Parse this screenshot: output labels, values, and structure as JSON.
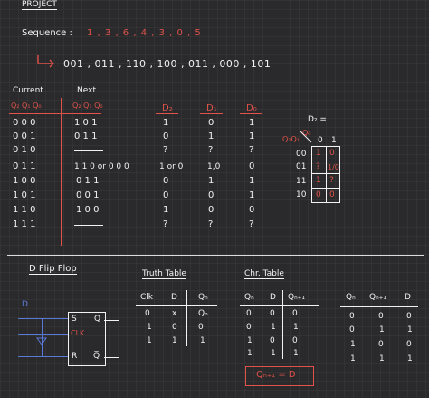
{
  "header": {
    "title": "PROJECT",
    "sequence_label": "Sequence :",
    "sequence_values": "1 , 3 , 6 , 4 , 3 , 0 , 5",
    "binary_sequence": "001 , 011 , 110 , 100 , 011 , 000 , 101"
  },
  "state_table": {
    "current_header": "Current",
    "next_header": "Next",
    "current_sub": "Q₂ Q₁ Q₀",
    "next_sub": "Q₂ Q₁ Q₀",
    "d_headers": [
      "D₂",
      "D₁",
      "D₀"
    ],
    "rows": [
      {
        "cur": "0  0  0",
        "next": "1  0  1",
        "d2": "1",
        "d1": "0",
        "d0": "1"
      },
      {
        "cur": "0  0  1",
        "next": "0  1  1",
        "d2": "0",
        "d1": "1",
        "d0": "1"
      },
      {
        "cur": "0  1  0",
        "next": "",
        "d2": "?",
        "d1": "?",
        "d0": "?"
      },
      {
        "cur": "0  1  1",
        "next": "1 1 0   or   0 0 0",
        "d2": "1 or 0",
        "d1": "1,0",
        "d0": "0"
      },
      {
        "cur": "1  0  0",
        "next": "0 1 1",
        "d2": "0",
        "d1": "1",
        "d0": "1"
      },
      {
        "cur": "1  0  1",
        "next": "0 0 1",
        "d2": "0",
        "d1": "0",
        "d0": "1"
      },
      {
        "cur": "1  1  0",
        "next": "1 0 0",
        "d2": "1",
        "d1": "0",
        "d0": "0"
      },
      {
        "cur": "1  1  1",
        "next": "",
        "d2": "?",
        "d1": "?",
        "d0": "?"
      }
    ]
  },
  "kmap": {
    "title": "D₂ =",
    "corner_label": "Q₂Q₁",
    "corner_label2": "Q₀",
    "col_headers": [
      "0",
      "1"
    ],
    "row_headers": [
      "00",
      "01",
      "11",
      "10"
    ],
    "cells": [
      [
        "1",
        "0"
      ],
      [
        "?",
        "1/0"
      ],
      [
        "1",
        "?"
      ],
      [
        "0",
        "0"
      ]
    ]
  },
  "flip_flop": {
    "title": "D  Flip Flop",
    "input_label": "D",
    "pin_s": "S",
    "pin_q": "Q",
    "pin_clk": "CLK",
    "pin_r": "R",
    "pin_qbar": "Q̅"
  },
  "truth_table": {
    "title": "Truth Table",
    "headers": [
      "Clk",
      "D",
      "Qₙ"
    ],
    "rows": [
      [
        "0",
        "x",
        "Qₙ"
      ],
      [
        "1",
        "0",
        "0"
      ],
      [
        "1",
        "1",
        "1"
      ]
    ]
  },
  "char_table": {
    "title": "Chr. Table",
    "headers": [
      "Qₙ",
      "D",
      "Qₙ₊₁"
    ],
    "rows": [
      [
        "0",
        "0",
        "0"
      ],
      [
        "0",
        "1",
        "1"
      ],
      [
        "1",
        "0",
        "0"
      ],
      [
        "1",
        "1",
        "1"
      ]
    ],
    "equation": "Qₙ₊₁ = D"
  },
  "excitation_table": {
    "headers": [
      "Qₙ",
      "Qₙ₊₁",
      "D"
    ],
    "rows": [
      [
        "0",
        "0",
        "0"
      ],
      [
        "0",
        "1",
        "1"
      ],
      [
        "1",
        "0",
        "0"
      ],
      [
        "1",
        "1",
        "1"
      ]
    ]
  },
  "colors": {
    "ink": "#f2f2f2",
    "accent": "#e0524a",
    "wire": "#5a78d6",
    "background": "#2a2a2c"
  }
}
